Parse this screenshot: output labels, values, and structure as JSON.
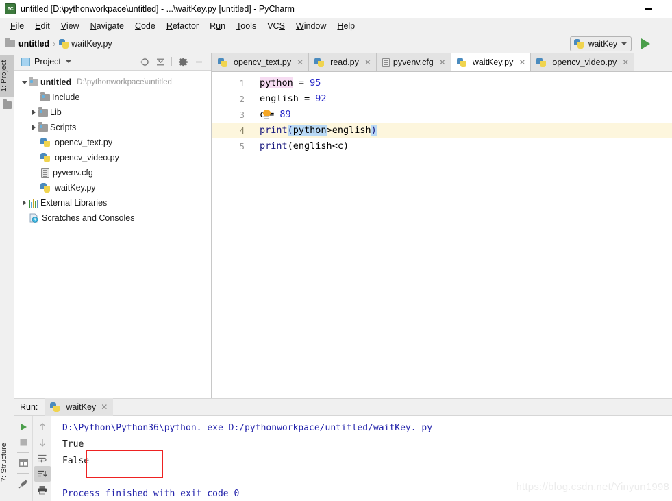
{
  "window": {
    "title": "untitled [D:\\pythonworkpace\\untitled] - ...\\waitKey.py [untitled] - PyCharm",
    "app_icon": "PC",
    "minimize_label": "—"
  },
  "menubar": {
    "items": [
      {
        "label": "File",
        "mnemonic": "F"
      },
      {
        "label": "Edit",
        "mnemonic": "E"
      },
      {
        "label": "View",
        "mnemonic": "V"
      },
      {
        "label": "Navigate",
        "mnemonic": "N"
      },
      {
        "label": "Code",
        "mnemonic": "C"
      },
      {
        "label": "Refactor",
        "mnemonic": "R"
      },
      {
        "label": "Run",
        "mnemonic": "u"
      },
      {
        "label": "Tools",
        "mnemonic": "T"
      },
      {
        "label": "VCS",
        "mnemonic": "S"
      },
      {
        "label": "Window",
        "mnemonic": "W"
      },
      {
        "label": "Help",
        "mnemonic": "H"
      }
    ]
  },
  "navbar": {
    "crumbs": [
      "untitled",
      "waitKey.py"
    ],
    "separator": "›"
  },
  "run_widget": {
    "config_name": "waitKey",
    "run_button_title": "Run"
  },
  "tool_strips": {
    "left_top": "1: Project",
    "left_bottom": "7: Structure"
  },
  "project_panel": {
    "title": "Project",
    "tools": [
      "locate-icon",
      "collapse-all-icon",
      "settings-gear-icon",
      "hide-icon"
    ],
    "tree": [
      {
        "label": "untitled",
        "path": "D:\\pythonworkpace\\untitled",
        "indent": 0,
        "arrow": "open",
        "icon": "folder-src",
        "bold": true
      },
      {
        "label": "Include",
        "path": "",
        "indent": 1,
        "arrow": "none",
        "icon": "folder-lib",
        "bold": false
      },
      {
        "label": "Lib",
        "path": "",
        "indent": 1,
        "arrow": "closed",
        "icon": "folder-lib",
        "bold": false
      },
      {
        "label": "Scripts",
        "path": "",
        "indent": 1,
        "arrow": "closed",
        "icon": "folder-lib",
        "bold": false
      },
      {
        "label": "opencv_text.py",
        "path": "",
        "indent": 1,
        "arrow": "none",
        "icon": "python-file",
        "bold": false
      },
      {
        "label": "opencv_video.py",
        "path": "",
        "indent": 1,
        "arrow": "none",
        "icon": "python-file",
        "bold": false
      },
      {
        "label": "pyvenv.cfg",
        "path": "",
        "indent": 1,
        "arrow": "none",
        "icon": "config-file",
        "bold": false
      },
      {
        "label": "waitKey.py",
        "path": "",
        "indent": 1,
        "arrow": "none",
        "icon": "python-file",
        "bold": false
      },
      {
        "label": "External Libraries",
        "path": "",
        "indent": 0,
        "arrow": "closed",
        "icon": "library",
        "bold": false
      },
      {
        "label": "Scratches and Consoles",
        "path": "",
        "indent": 0,
        "arrow": "none",
        "icon": "scratches",
        "bold": false
      }
    ]
  },
  "editor": {
    "tabs": [
      {
        "label": "opencv_text.py",
        "icon": "python-file",
        "active": false
      },
      {
        "label": "read.py",
        "icon": "python-file",
        "active": false
      },
      {
        "label": "pyvenv.cfg",
        "icon": "config-file",
        "active": false
      },
      {
        "label": "waitKey.py",
        "icon": "python-file",
        "active": true
      },
      {
        "label": "opencv_video.py",
        "icon": "python-file",
        "active": false
      }
    ],
    "line_numbers": [
      "1",
      "2",
      "3",
      "4",
      "5"
    ],
    "caret_line": 4,
    "code": [
      {
        "n": "1",
        "text": "python = 95"
      },
      {
        "n": "2",
        "text": "english = 92"
      },
      {
        "n": "3",
        "text": "c = 89"
      },
      {
        "n": "4",
        "text": "print(python>english)"
      },
      {
        "n": "5",
        "text": "print(english<c)"
      }
    ],
    "gutter_intention": "lightbulb-icon"
  },
  "run_panel": {
    "label": "Run:",
    "tab_label": "waitKey",
    "left_buttons": [
      "rerun-icon",
      "stop-icon",
      "console-icon",
      "pin-icon"
    ],
    "right_buttons": [
      "up-arrow-icon",
      "down-arrow-icon",
      "soft-wrap-icon",
      "scroll-to-end-icon",
      "print-icon"
    ],
    "output": [
      {
        "text": "D:\\Python\\Python36\\python. exe D:/pythonworkpace/untitled/waitKey. py",
        "color": "blue"
      },
      {
        "text": "True",
        "color": "black"
      },
      {
        "text": "False",
        "color": "black"
      },
      {
        "text": "",
        "color": "black"
      },
      {
        "text": "Process finished with exit code 0",
        "color": "blue"
      }
    ],
    "annotation_box": "red-highlight-box"
  },
  "watermark": {
    "text": "https://blog.csdn.net/Yinyun1998"
  },
  "colors": {
    "accent_green": "#4a9e4a",
    "annotation_red": "#ee2222",
    "caret_line": "#fdf6dd",
    "selection_blue": "#b9d9f5",
    "identifier_pink": "#f6dcf2",
    "console_blue": "#2222aa"
  }
}
